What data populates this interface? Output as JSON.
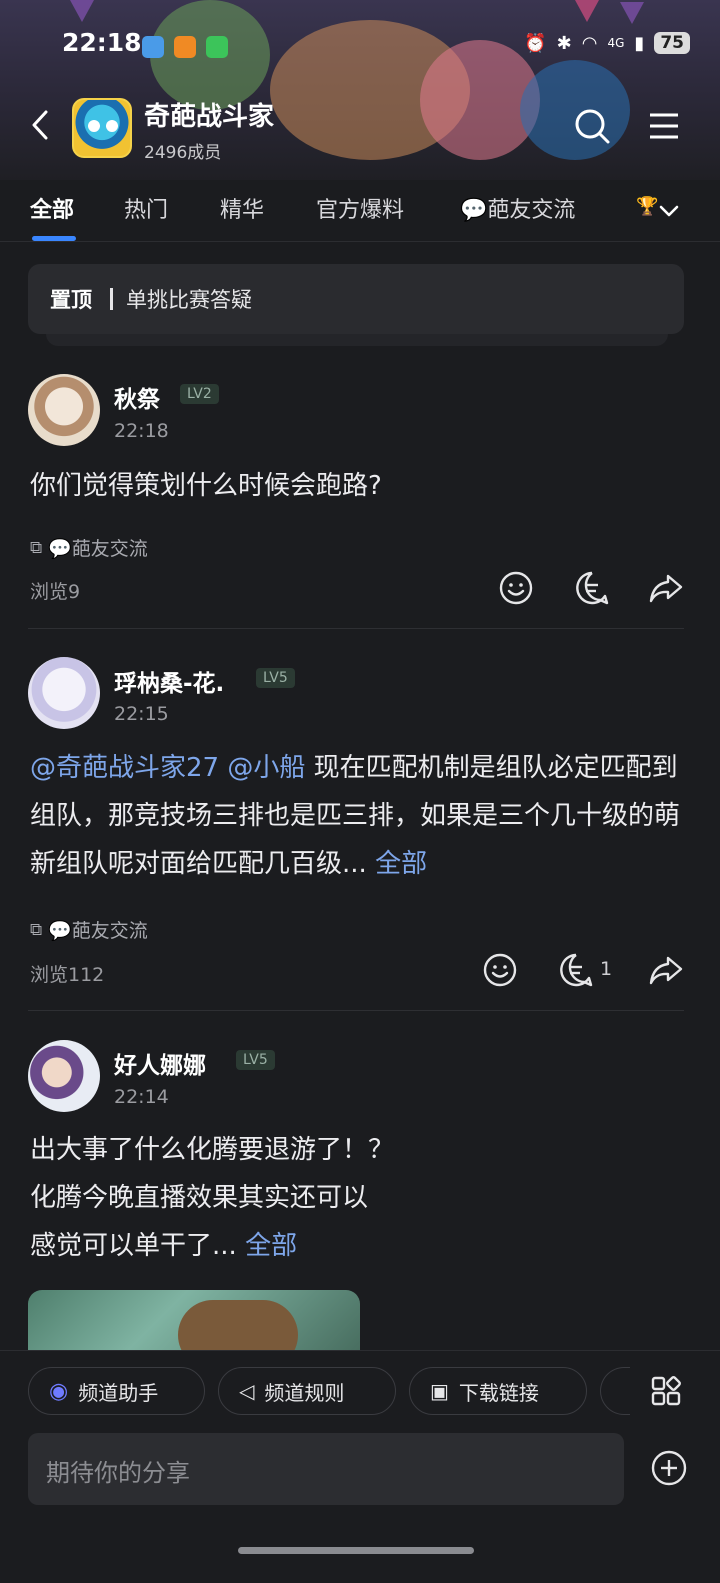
{
  "status_bar": {
    "time": "22:18",
    "network": "4G",
    "battery": "75"
  },
  "header": {
    "group_name": "奇葩战斗家",
    "members": "2496成员"
  },
  "tabs": [
    "全部",
    "热门",
    "精华",
    "官方爆料",
    "💬葩友交流"
  ],
  "pinned": {
    "tag": "置顶",
    "text": "单挑比赛答疑"
  },
  "posts": [
    {
      "username": "秋祭",
      "level": "LV2",
      "time": "22:18",
      "text": "你们觉得策划什么时候会跑路?",
      "channel": "💬葩友交流",
      "views": "浏览9",
      "comment_count": ""
    },
    {
      "username": "琈枘桑-花.",
      "level": "LV5",
      "time": "22:15",
      "mention1": "@奇葩战斗家27",
      "mention2": "@小船",
      "text": "现在匹配机制是组队必定匹配到组队，那竞技场三排也是匹三排，如果是三个几十级的萌新组队呢对面给匹配几百级...",
      "more": "全部",
      "channel": "💬葩友交流",
      "views": "浏览112",
      "comment_count": "1"
    },
    {
      "username": "好人娜娜",
      "level": "LV5",
      "time": "22:14",
      "line1": "出大事了什么化腾要退游了！？",
      "line2": "化腾今晚直播效果其实还可以",
      "line3": "感觉可以单干了...",
      "more": "全部"
    }
  ],
  "bottom": {
    "chips": [
      "频道助手",
      "频道规则",
      "下载链接"
    ],
    "input_placeholder": "期待你的分享"
  },
  "colors": {
    "accent": "#3a86ff",
    "link": "#7ea6ea",
    "background": "#1b1c1f"
  }
}
